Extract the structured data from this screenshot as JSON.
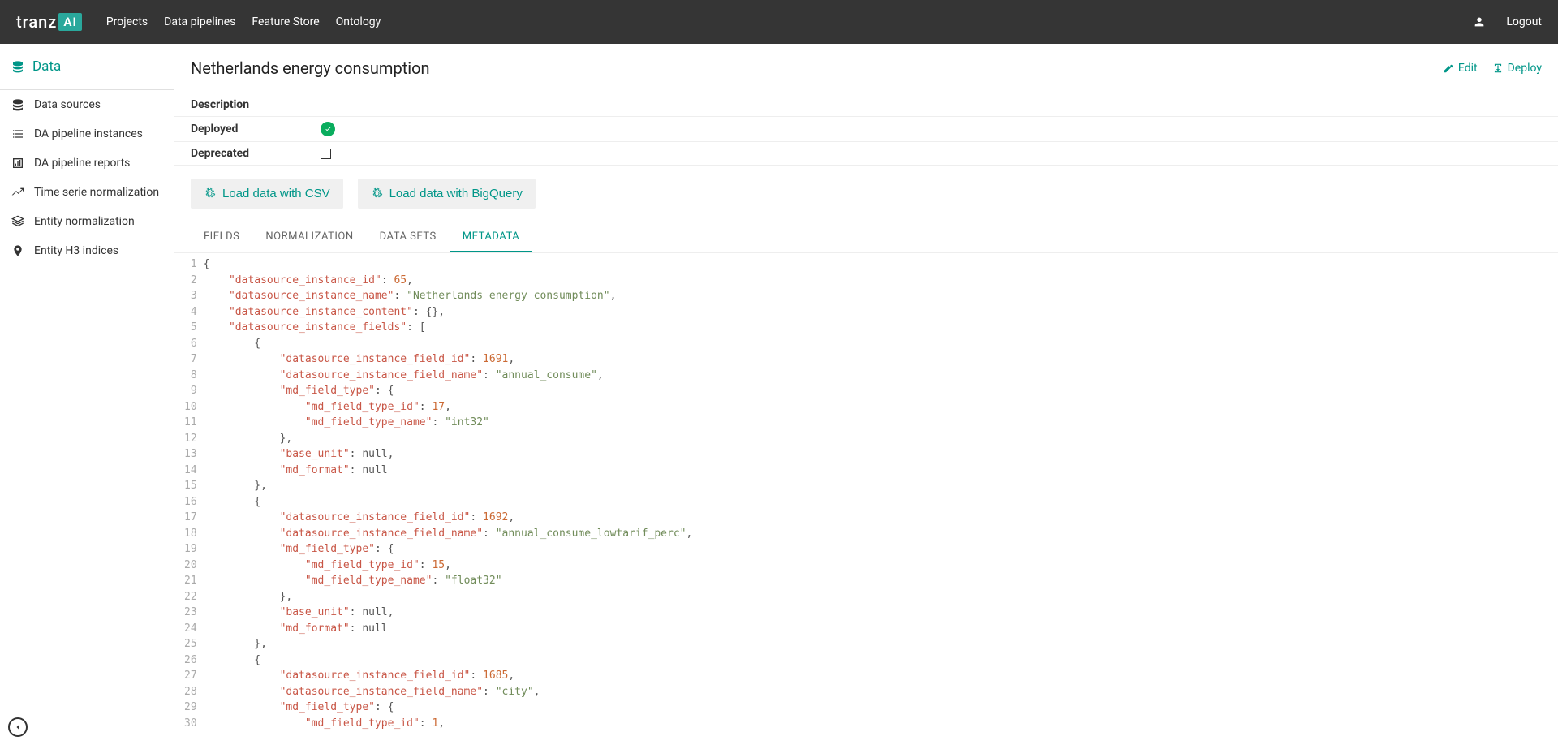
{
  "brand": {
    "text": "tranz",
    "box": "AI"
  },
  "nav": [
    "Projects",
    "Data pipelines",
    "Feature Store",
    "Ontology"
  ],
  "logout": "Logout",
  "sidebar": {
    "header": "Data",
    "items": [
      "Data sources",
      "DA pipeline instances",
      "DA pipeline reports",
      "Time serie normalization",
      "Entity normalization",
      "Entity H3 indices"
    ]
  },
  "page": {
    "title": "Netherlands energy consumption",
    "edit": "Edit",
    "deploy": "Deploy",
    "info": {
      "description": "Description",
      "deployed": "Deployed",
      "deprecated": "Deprecated"
    },
    "buttons": {
      "csv": "Load data with CSV",
      "bq": "Load data with BigQuery"
    },
    "tabs": [
      "FIELDS",
      "NORMALIZATION",
      "DATA SETS",
      "METADATA"
    ],
    "activeTab": 3
  },
  "code": [
    [
      [
        "p",
        "{"
      ]
    ],
    [
      [
        "p",
        "    "
      ],
      [
        "k",
        "\"datasource_instance_id\""
      ],
      [
        "p",
        ": "
      ],
      [
        "n",
        "65"
      ],
      [
        "p",
        ","
      ]
    ],
    [
      [
        "p",
        "    "
      ],
      [
        "k",
        "\"datasource_instance_name\""
      ],
      [
        "p",
        ": "
      ],
      [
        "s",
        "\"Netherlands energy consumption\""
      ],
      [
        "p",
        ","
      ]
    ],
    [
      [
        "p",
        "    "
      ],
      [
        "k",
        "\"datasource_instance_content\""
      ],
      [
        "p",
        ": {},"
      ]
    ],
    [
      [
        "p",
        "    "
      ],
      [
        "k",
        "\"datasource_instance_fields\""
      ],
      [
        "p",
        ": ["
      ]
    ],
    [
      [
        "p",
        "        {"
      ]
    ],
    [
      [
        "p",
        "            "
      ],
      [
        "k",
        "\"datasource_instance_field_id\""
      ],
      [
        "p",
        ": "
      ],
      [
        "n",
        "1691"
      ],
      [
        "p",
        ","
      ]
    ],
    [
      [
        "p",
        "            "
      ],
      [
        "k",
        "\"datasource_instance_field_name\""
      ],
      [
        "p",
        ": "
      ],
      [
        "s",
        "\"annual_consume\""
      ],
      [
        "p",
        ","
      ]
    ],
    [
      [
        "p",
        "            "
      ],
      [
        "k",
        "\"md_field_type\""
      ],
      [
        "p",
        ": {"
      ]
    ],
    [
      [
        "p",
        "                "
      ],
      [
        "k",
        "\"md_field_type_id\""
      ],
      [
        "p",
        ": "
      ],
      [
        "n",
        "17"
      ],
      [
        "p",
        ","
      ]
    ],
    [
      [
        "p",
        "                "
      ],
      [
        "k",
        "\"md_field_type_name\""
      ],
      [
        "p",
        ": "
      ],
      [
        "s",
        "\"int32\""
      ]
    ],
    [
      [
        "p",
        "            },"
      ]
    ],
    [
      [
        "p",
        "            "
      ],
      [
        "k",
        "\"base_unit\""
      ],
      [
        "p",
        ": "
      ],
      [
        "null",
        "null"
      ],
      [
        "p",
        ","
      ]
    ],
    [
      [
        "p",
        "            "
      ],
      [
        "k",
        "\"md_format\""
      ],
      [
        "p",
        ": "
      ],
      [
        "null",
        "null"
      ]
    ],
    [
      [
        "p",
        "        },"
      ]
    ],
    [
      [
        "p",
        "        {"
      ]
    ],
    [
      [
        "p",
        "            "
      ],
      [
        "k",
        "\"datasource_instance_field_id\""
      ],
      [
        "p",
        ": "
      ],
      [
        "n",
        "1692"
      ],
      [
        "p",
        ","
      ]
    ],
    [
      [
        "p",
        "            "
      ],
      [
        "k",
        "\"datasource_instance_field_name\""
      ],
      [
        "p",
        ": "
      ],
      [
        "s",
        "\"annual_consume_lowtarif_perc\""
      ],
      [
        "p",
        ","
      ]
    ],
    [
      [
        "p",
        "            "
      ],
      [
        "k",
        "\"md_field_type\""
      ],
      [
        "p",
        ": {"
      ]
    ],
    [
      [
        "p",
        "                "
      ],
      [
        "k",
        "\"md_field_type_id\""
      ],
      [
        "p",
        ": "
      ],
      [
        "n",
        "15"
      ],
      [
        "p",
        ","
      ]
    ],
    [
      [
        "p",
        "                "
      ],
      [
        "k",
        "\"md_field_type_name\""
      ],
      [
        "p",
        ": "
      ],
      [
        "s",
        "\"float32\""
      ]
    ],
    [
      [
        "p",
        "            },"
      ]
    ],
    [
      [
        "p",
        "            "
      ],
      [
        "k",
        "\"base_unit\""
      ],
      [
        "p",
        ": "
      ],
      [
        "null",
        "null"
      ],
      [
        "p",
        ","
      ]
    ],
    [
      [
        "p",
        "            "
      ],
      [
        "k",
        "\"md_format\""
      ],
      [
        "p",
        ": "
      ],
      [
        "null",
        "null"
      ]
    ],
    [
      [
        "p",
        "        },"
      ]
    ],
    [
      [
        "p",
        "        {"
      ]
    ],
    [
      [
        "p",
        "            "
      ],
      [
        "k",
        "\"datasource_instance_field_id\""
      ],
      [
        "p",
        ": "
      ],
      [
        "n",
        "1685"
      ],
      [
        "p",
        ","
      ]
    ],
    [
      [
        "p",
        "            "
      ],
      [
        "k",
        "\"datasource_instance_field_name\""
      ],
      [
        "p",
        ": "
      ],
      [
        "s",
        "\"city\""
      ],
      [
        "p",
        ","
      ]
    ],
    [
      [
        "p",
        "            "
      ],
      [
        "k",
        "\"md_field_type\""
      ],
      [
        "p",
        ": {"
      ]
    ],
    [
      [
        "p",
        "                "
      ],
      [
        "k",
        "\"md_field_type_id\""
      ],
      [
        "p",
        ": "
      ],
      [
        "n",
        "1"
      ],
      [
        "p",
        ","
      ]
    ]
  ]
}
